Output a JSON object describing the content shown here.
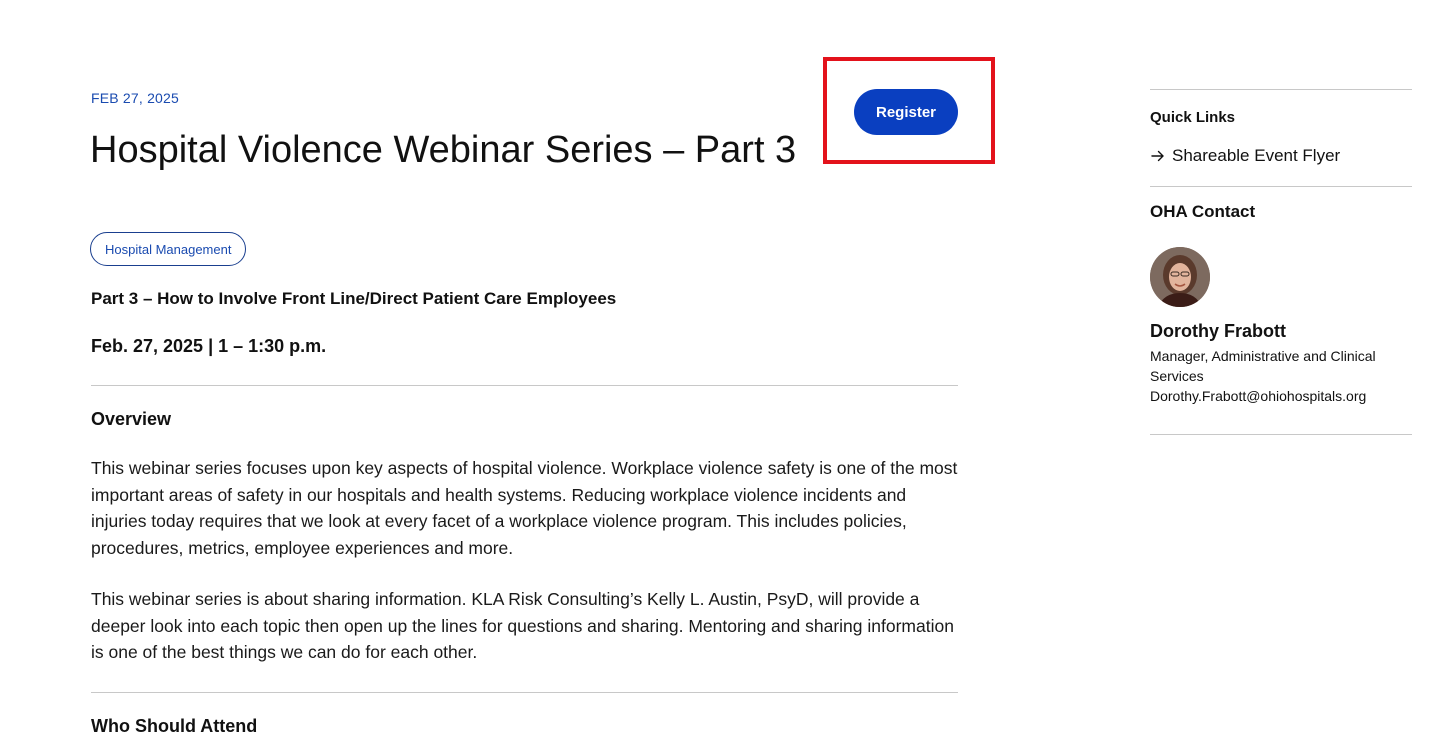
{
  "event": {
    "date": "FEB 27, 2025",
    "title": "Hospital Violence Webinar Series – Part 3",
    "register_label": "Register",
    "tag": "Hospital Management",
    "subtitle": "Part 3 – How to Involve Front Line/Direct Patient Care Employees",
    "when": "Feb. 27, 2025 | 1 – 1:30 p.m."
  },
  "overview": {
    "heading": "Overview",
    "paragraphs": [
      "This webinar series focuses upon key aspects of hospital violence. Workplace violence safety is one of the most important areas of safety in our hospitals and health systems. Reducing workplace violence incidents and injuries today requires that we look at every facet of a workplace violence program. This includes policies, procedures, metrics, employee experiences and more.",
      "This webinar series is about sharing information. KLA Risk Consulting’s Kelly L. Austin, PsyD, will provide a deeper look into each topic then open up the lines for questions and sharing. Mentoring and sharing information is one of the best things we can do for each other."
    ]
  },
  "who_should_attend": {
    "heading": "Who Should Attend"
  },
  "sidebar": {
    "quick_links_heading": "Quick Links",
    "quick_links": [
      {
        "label": "Shareable Event Flyer",
        "icon": "arrow-right-icon"
      }
    ],
    "contact_heading": "OHA Contact",
    "contact": {
      "name": "Dorothy Frabott",
      "role": "Manager, Administrative and Clinical Services",
      "email": "Dorothy.Frabott@ohiohospitals.org"
    }
  },
  "colors": {
    "accent_blue": "#0a3fc0",
    "date_blue": "#1a4bb0",
    "highlight_red": "#e3121b"
  }
}
